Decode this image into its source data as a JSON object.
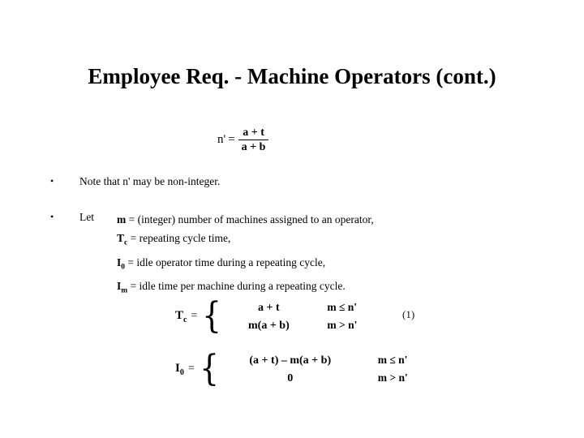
{
  "slide": {
    "title": "Employee Req. - Machine Operators (cont.)",
    "background_color": "#ffffff",
    "text_color": "#000000"
  },
  "equation_nprime": {
    "lhs": "n'",
    "equals": "=",
    "numerator": "a + t",
    "denominator": "a + b"
  },
  "bullets": [
    {
      "marker": "•",
      "text": "Note that n' may be non-integer."
    },
    {
      "marker": "•",
      "label": "Let",
      "definitions": [
        {
          "symbol": "m",
          "subscript": "",
          "text": "= (integer) number of machines assigned to an operator,"
        },
        {
          "symbol": "T",
          "subscript": "c",
          "text": "= repeating cycle time,"
        },
        {
          "symbol": "I",
          "subscript": "0",
          "text": "= idle operator time during a repeating cycle,"
        },
        {
          "symbol": "I",
          "subscript": "m",
          "text": "= idle time per machine during a repeating cycle."
        }
      ]
    }
  ],
  "equation_tc": {
    "lhs_symbol": "T",
    "lhs_subscript": "c",
    "equals": "=",
    "brace": "{",
    "rows": [
      {
        "value": "a + t",
        "condition": "m ≤ n'"
      },
      {
        "value": "m(a + b)",
        "condition": "m > n'"
      }
    ]
  },
  "equation_i0": {
    "lhs_symbol": "I",
    "lhs_subscript": "0",
    "equals": "=",
    "brace": "{",
    "rows": [
      {
        "value": "(a + t) – m(a + b)",
        "condition": "m ≤ n'"
      },
      {
        "value": "0",
        "condition": "m > n'"
      }
    ]
  },
  "equation_number": "(1)"
}
